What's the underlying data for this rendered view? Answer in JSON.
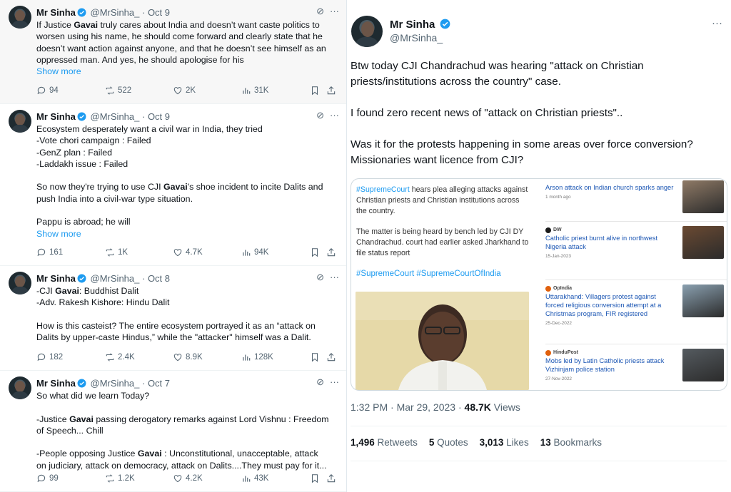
{
  "tweets": [
    {
      "name": "Mr Sinha",
      "handle": "@MrSinha_",
      "date": "· Oct 9",
      "lines": [
        [
          "If Justice ",
          "Gavai",
          " truly cares about India and doesn’t want caste politics to"
        ],
        [
          "worsen using his name, he should come forward and clearly state that he",
          "",
          ""
        ],
        [
          "doesn’t want action against anyone, and that he doesn’t see himself as an",
          "",
          ""
        ],
        [
          "oppressed man. And yes, he should apologise for his",
          "",
          ""
        ]
      ],
      "show_more": "Show more",
      "replies": "94",
      "retweets": "522",
      "likes": "2K",
      "views": "31K"
    },
    {
      "name": "Mr Sinha",
      "handle": "@MrSinha_",
      "date": "· Oct 9",
      "lines": [
        [
          "Ecosystem desperately want a civil war in India, they tried",
          "",
          ""
        ],
        [
          "-Vote chori campaign : Failed",
          "",
          ""
        ],
        [
          "-GenZ plan : Failed",
          "",
          ""
        ],
        [
          "-Laddakh issue : Failed",
          "",
          ""
        ],
        [
          "",
          "",
          ""
        ],
        [
          "So now they're trying to use CJI ",
          "Gavai",
          "'s shoe incident to incite Dalits and"
        ],
        [
          "push India into a civil-war type situation.",
          "",
          ""
        ],
        [
          "",
          "",
          ""
        ],
        [
          "Pappu is abroad; he will",
          "",
          ""
        ]
      ],
      "show_more": "Show more",
      "replies": "161",
      "retweets": "1K",
      "likes": "4.7K",
      "views": "94K"
    },
    {
      "name": "Mr Sinha",
      "handle": "@MrSinha_",
      "date": "· Oct 8",
      "lines": [
        [
          "-CJI ",
          "Gavai",
          ": Buddhist Dalit"
        ],
        [
          "-Adv. Rakesh Kishore: Hindu Dalit",
          "",
          ""
        ],
        [
          "",
          "",
          ""
        ],
        [
          "How is this casteist? The entire ecosystem portrayed it as an “attack on",
          "",
          ""
        ],
        [
          "Dalits by upper-caste Hindus,” while the \"attacker\" himself was a Dalit.",
          "",
          ""
        ]
      ],
      "show_more": "",
      "replies": "182",
      "retweets": "2.4K",
      "likes": "8.9K",
      "views": "128K"
    },
    {
      "name": "Mr Sinha",
      "handle": "@MrSinha_",
      "date": "· Oct 7",
      "lines": [
        [
          "So what did we learn Today?",
          "",
          ""
        ],
        [
          "",
          "",
          ""
        ],
        [
          "-Justice ",
          "Gavai",
          " passing derogatory remarks against Lord Vishnu : Freedom"
        ],
        [
          "of Speech... Chill",
          "",
          ""
        ],
        [
          "",
          "",
          ""
        ],
        [
          "-People opposing Justice ",
          "Gavai",
          " : Unconstitutional, unacceptable, attack"
        ],
        [
          "on judiciary, attack on democracy, attack on Dalits....They must pay for it...",
          "",
          ""
        ]
      ],
      "show_more": "",
      "replies": "99",
      "retweets": "1.2K",
      "likes": "4.2K",
      "views": "43K"
    }
  ],
  "main": {
    "name": "Mr Sinha",
    "handle": "@MrSinha_",
    "more": "···",
    "paragraphs": [
      "Btw today CJI Chandrachud was hearing \"attack on Christian priests/institutions across the country\" case.",
      "I found zero recent news of \"attack on Christian priests\"..",
      "Was it for the protests happening in some areas over force conversion? Missionaries want licence from CJI?"
    ],
    "card": {
      "tag1": "#SupremeCourt",
      "text1": " hears plea alleging attacks against Christian priests and Christian institutions across the country.",
      "text2": "The matter is being heard by bench led by CJI DY Chandrachud. court had earlier asked Jharkhand to file status report",
      "tags2": "#SupremeCourt #SupremeCourtOfIndia",
      "news": [
        {
          "source": "",
          "title": "Arson attack on Indian church sparks anger",
          "date": "1 month ago"
        },
        {
          "source": "DW",
          "title": "Catholic priest burnt alive in northwest Nigeria attack",
          "date": "15-Jan-2023"
        },
        {
          "source": "OpIndia",
          "title": "Uttarakhand: Villagers protest against forced religious conversion attempt at a Christmas program, FIR registered",
          "date": "25-Dec-2022"
        },
        {
          "source": "HinduPost",
          "title": "Mobs led by Latin Catholic priests attack Vizhinjam police station",
          "date": "27-Nov-2022"
        }
      ]
    },
    "time": "1:32 PM · Mar 29, 2023 · ",
    "views_count": "48.7K",
    "views_label": " Views",
    "retweets_count": "1,496",
    "retweets_label": " Retweets",
    "quotes_count": "5",
    "quotes_label": " Quotes",
    "likes_count": "3,013",
    "likes_label": " Likes",
    "bookmarks_count": "13",
    "bookmarks_label": " Bookmarks"
  },
  "colors": {
    "accent": "#1d9bf0",
    "text": "#0f1419",
    "muted": "#536471"
  }
}
